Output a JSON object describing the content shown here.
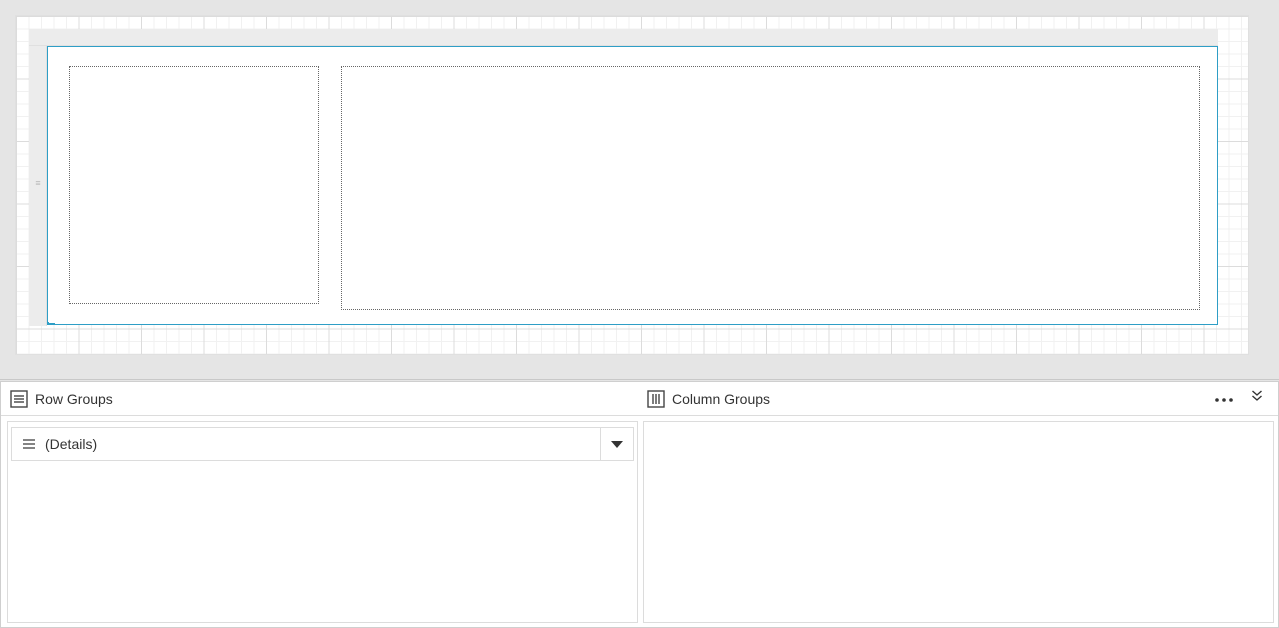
{
  "canvas": {
    "accent_color": "#2e9ec6",
    "grid_line_color": "#dcdcdc",
    "row_grip_glyph": "≡"
  },
  "group_panel": {
    "row_groups": {
      "label": "Row Groups",
      "icon": "row-groups-icon",
      "items": [
        {
          "label": "(Details)",
          "icon": "details-lines-icon",
          "dropdown_icon": "caret-down-icon"
        }
      ]
    },
    "column_groups": {
      "label": "Column Groups",
      "icon": "column-groups-icon",
      "items": []
    },
    "more_icon": "ellipsis-icon",
    "collapse_icon": "double-chevron-down-icon"
  }
}
